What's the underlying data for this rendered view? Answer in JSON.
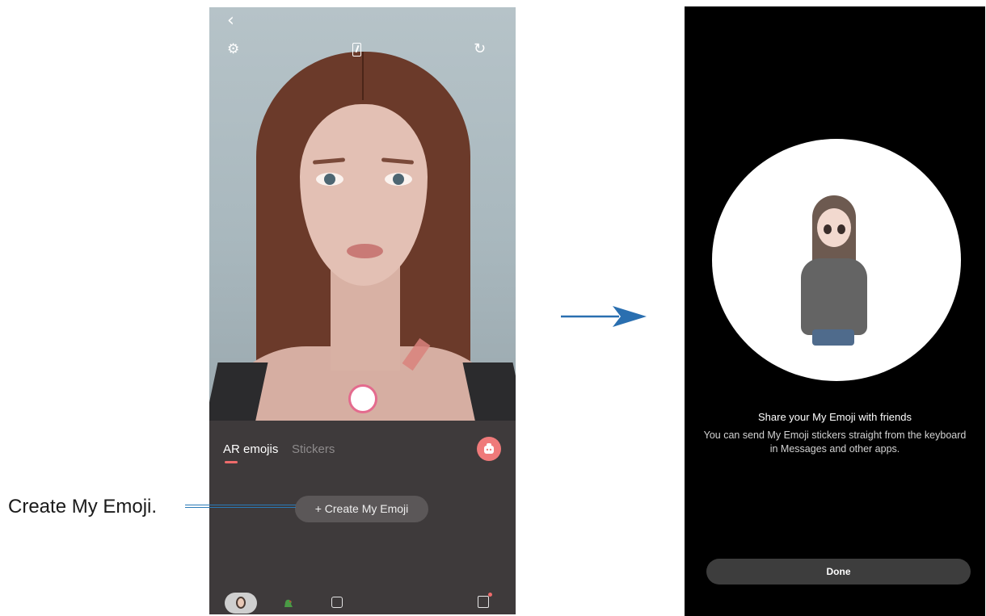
{
  "left_phone": {
    "camera": {
      "icons": [
        "back-arrow-icon",
        "settings-gear-icon",
        "aspect-ratio-icon",
        "switch-camera-icon"
      ]
    },
    "panel": {
      "tabs": [
        {
          "label": "AR emojis",
          "selected": true
        },
        {
          "label": "Stickers",
          "selected": false
        }
      ],
      "create_button_label": "+ Create My Emoji",
      "bottom_icons": [
        "my-emoji-avatar-icon",
        "dinosaur-sticker-icon",
        "sticker-settings-icon",
        "store-bag-icon"
      ],
      "accent_color": "#ef6b6b"
    }
  },
  "right_phone": {
    "share_title": "Share your My Emoji with friends",
    "share_description": "You can send My Emoji stickers straight from the keyboard\nin Messages and other apps.",
    "done_label": "Done"
  },
  "annotation": {
    "callout_text": "Create My Emoji.",
    "leader_color": "#2a7ab7"
  },
  "arrow_color": "#2a6fb0"
}
